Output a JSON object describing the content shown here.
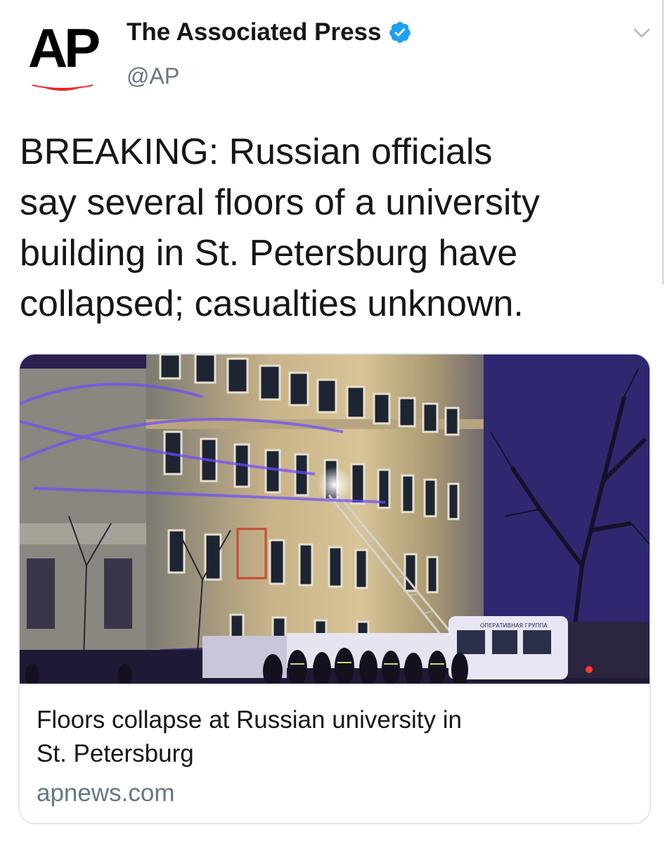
{
  "account": {
    "logo_text": "AP",
    "name": "The Associated Press",
    "handle": "@AP",
    "verified": true
  },
  "tweet": {
    "text": "BREAKING: Russian officials\nsay several floors of a university\nbuilding in St. Petersburg have\ncollapsed; casualties unknown."
  },
  "link_card": {
    "image_sign_text": "ОПЕРАТИВНАЯ ГРУППА",
    "title": "Floors collapse at Russian university in\nSt. Petersburg",
    "domain": "apnews.com"
  },
  "icons": {
    "verified": "verified-badge-icon",
    "menu": "chevron-down-icon"
  },
  "colors": {
    "verified_blue": "#1da1f2",
    "ap_red": "#e3211f",
    "secondary_text": "#657786",
    "border": "#e1e8ed"
  }
}
